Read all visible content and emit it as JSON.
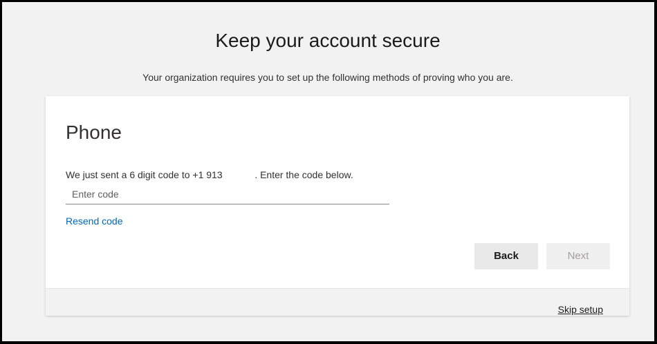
{
  "header": {
    "title": "Keep your account secure",
    "subtitle": "Your organization requires you to set up the following methods of proving who you are."
  },
  "card": {
    "method_title": "Phone",
    "instruction": "We just sent a 6 digit code to +1 913            . Enter the code below.",
    "code_input": {
      "placeholder": "Enter code",
      "value": ""
    },
    "resend_label": "Resend code",
    "back_label": "Back",
    "next_label": "Next",
    "next_enabled": false
  },
  "footer": {
    "skip_label": "Skip setup"
  },
  "colors": {
    "link": "#0067b8",
    "page_background": "#f2f2f2",
    "card_background": "#ffffff",
    "disabled_text": "#a19f9d"
  }
}
